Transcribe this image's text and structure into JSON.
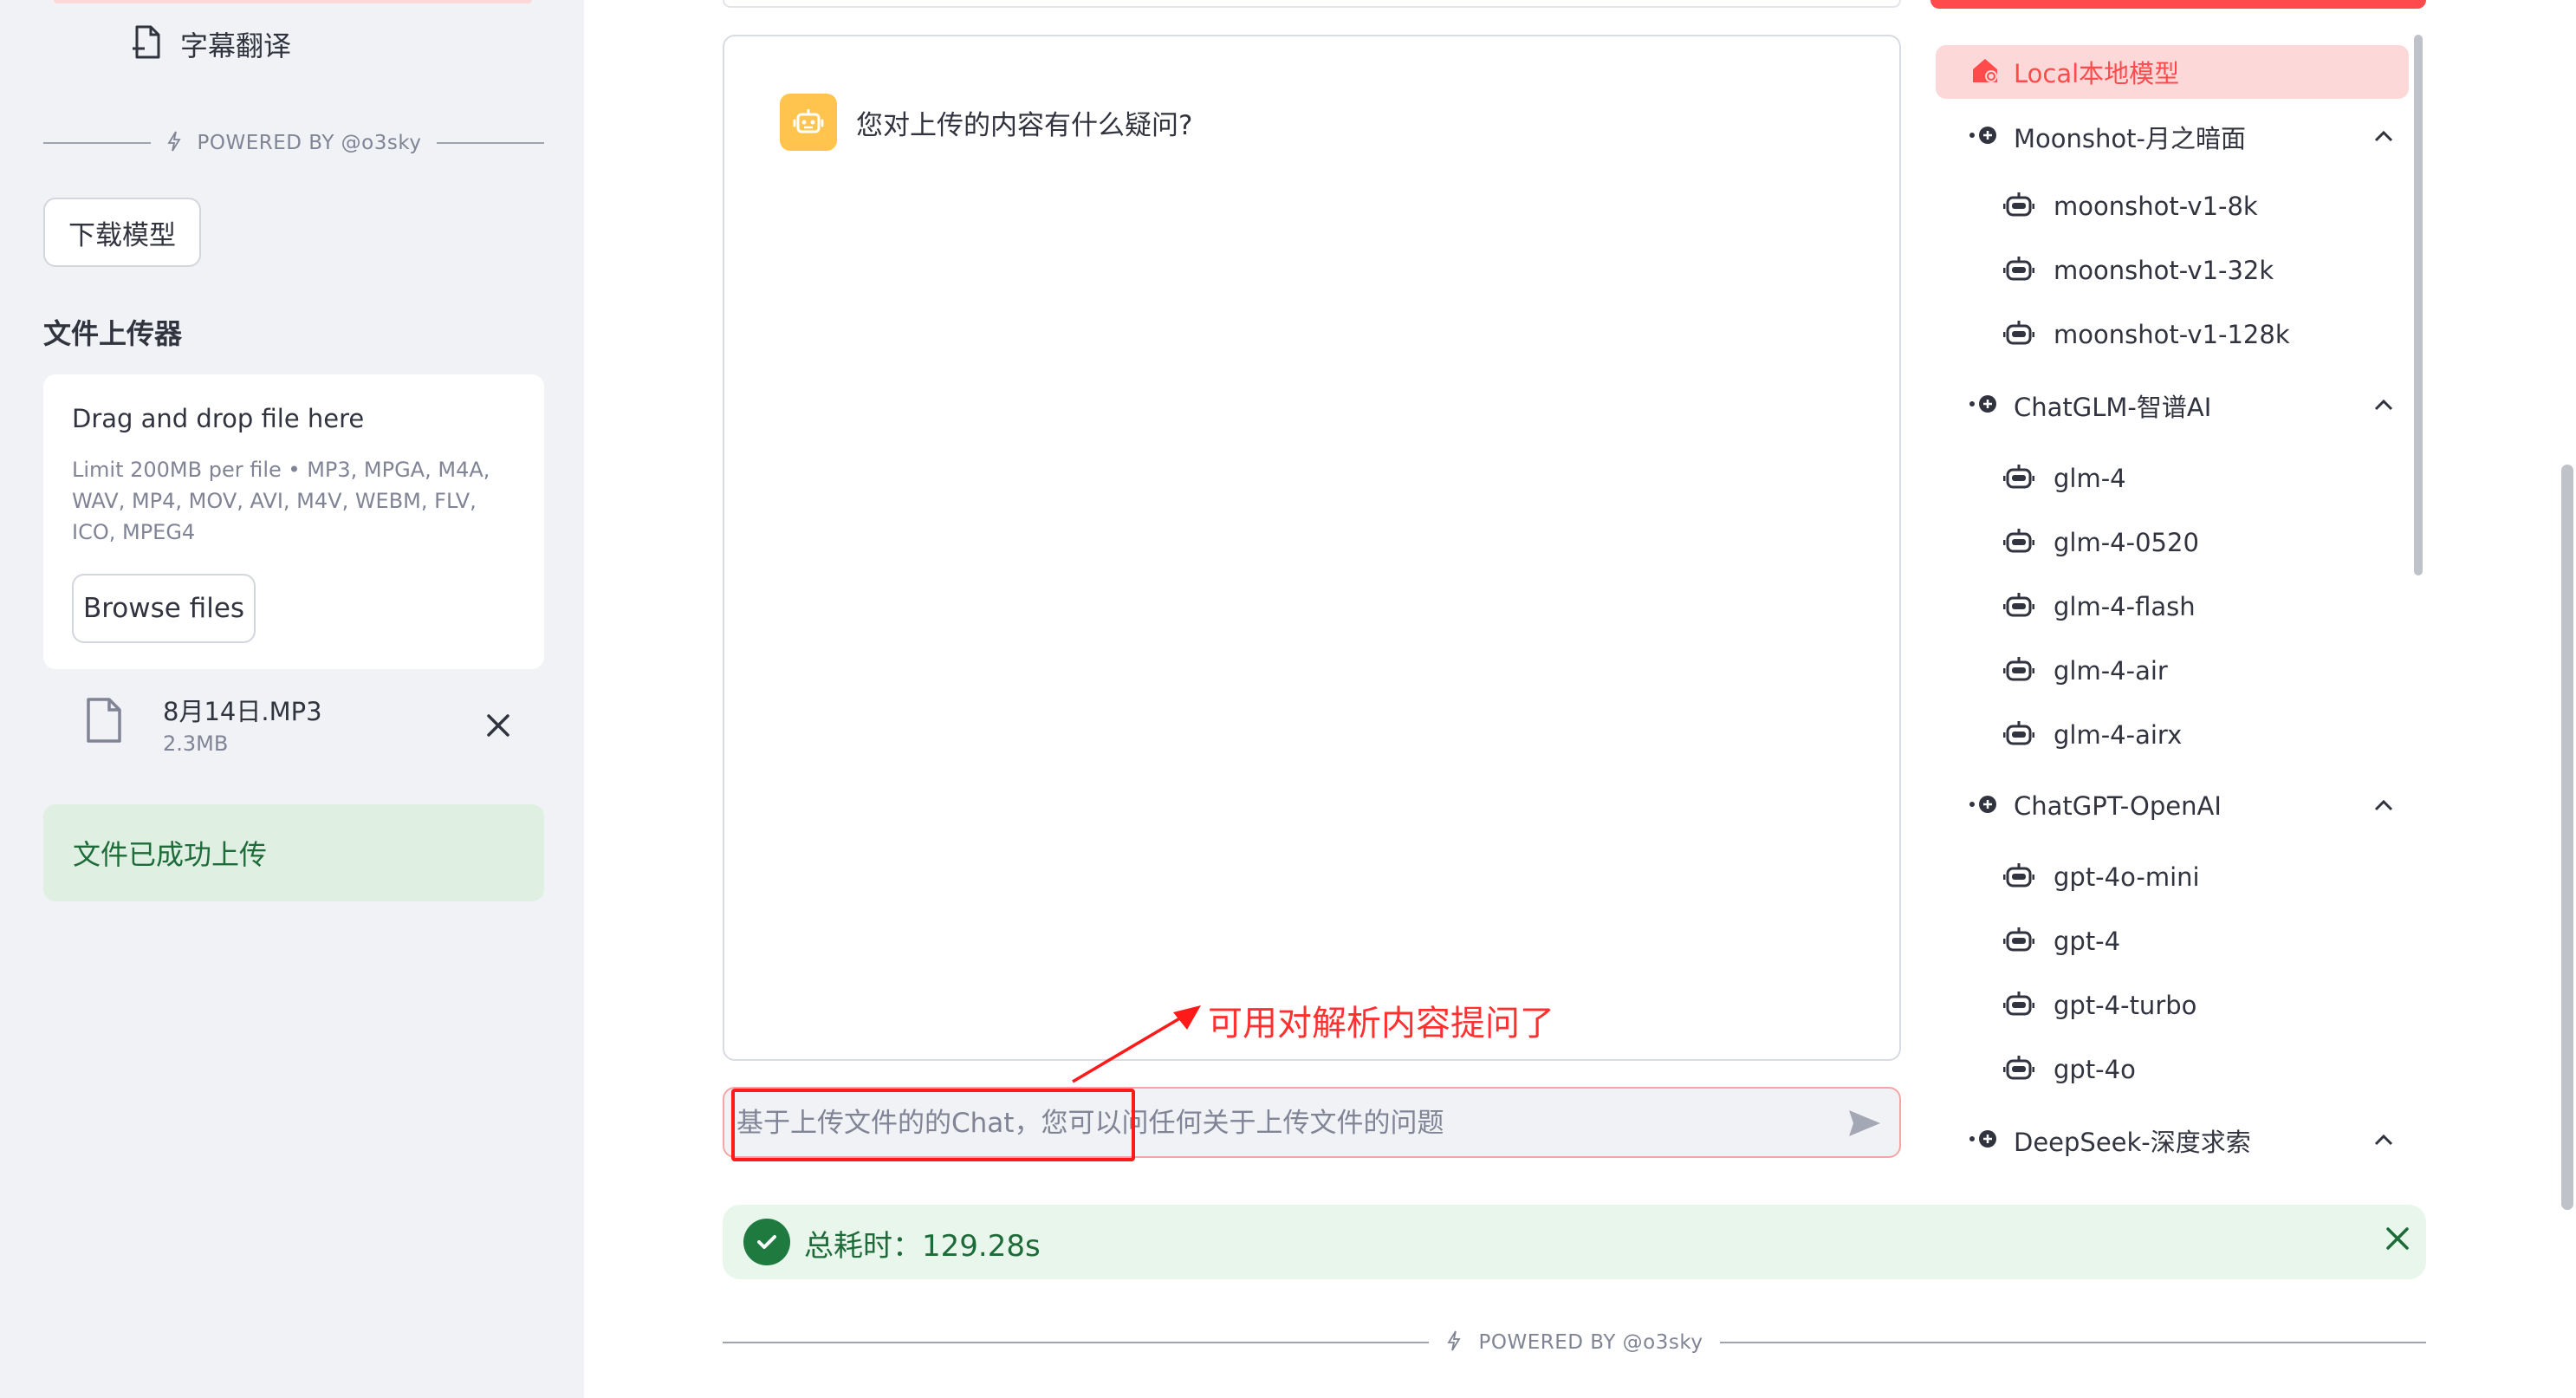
{
  "sidebar": {
    "nav_item_label": "字幕翻译",
    "powered_by": "POWERED BY @o3sky",
    "download_button": "下载模型",
    "uploader_title": "文件上传器",
    "dropzone": {
      "title": "Drag and drop file here",
      "limit": "Limit 200MB per file • MP3, MPGA, M4A, WAV, MP4, MOV, AVI, M4V, WEBM, FLV, ICO, MPEG4",
      "browse_button": "Browse files"
    },
    "file": {
      "name": "8月14日.MP3",
      "size": "2.3MB"
    },
    "success_message": "文件已成功上传"
  },
  "main": {
    "assistant_message": "您对上传的内容有什么疑问?",
    "annotation": "可用对解析内容提问了",
    "chat_input_placeholder": "基于上传文件的的Chat，您可以问任何关于上传文件的问题",
    "toast": "总耗时：129.28s",
    "footer": "POWERED BY @o3sky"
  },
  "models": {
    "selected": "Local本地模型",
    "groups": [
      {
        "name": "Moonshot-月之暗面",
        "items": [
          "moonshot-v1-8k",
          "moonshot-v1-32k",
          "moonshot-v1-128k"
        ]
      },
      {
        "name": "ChatGLM-智谱AI",
        "items": [
          "glm-4",
          "glm-4-0520",
          "glm-4-flash",
          "glm-4-air",
          "glm-4-airx"
        ]
      },
      {
        "name": "ChatGPT-OpenAI",
        "items": [
          "gpt-4o-mini",
          "gpt-4",
          "gpt-4-turbo",
          "gpt-4o"
        ]
      },
      {
        "name": "DeepSeek-深度求索",
        "items": []
      }
    ]
  },
  "colors": {
    "accent": "#ff4b4b",
    "sidebar_bg": "#f0f2f6",
    "success_bg": "#dff0e3",
    "success_text": "#1d6b38",
    "annotation_red": "#ff1a1a",
    "bot_avatar": "#ffc44d"
  }
}
